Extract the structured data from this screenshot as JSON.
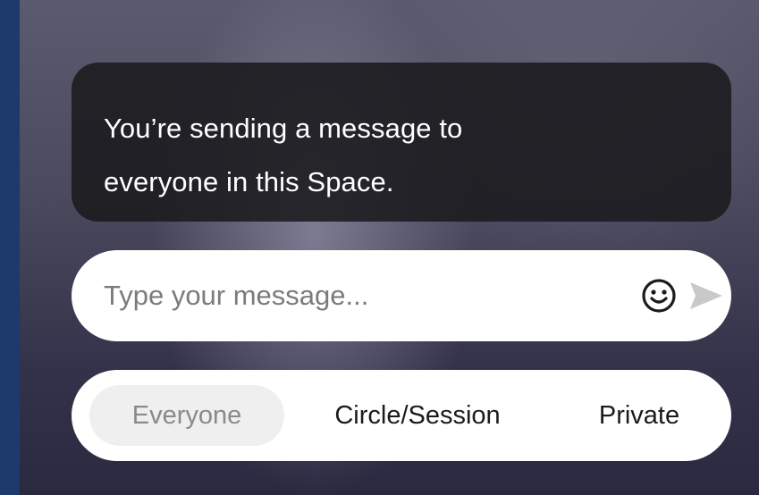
{
  "notice": {
    "line1": "You’re sending a message to",
    "line2": "everyone in this Space."
  },
  "composer": {
    "placeholder": "Type your message...",
    "emoji_icon": "smiley-face-icon",
    "send_icon": "paper-plane-send-icon"
  },
  "audience": {
    "options": [
      "Everyone",
      "Circle/Session",
      "Private"
    ],
    "selected": "Everyone"
  },
  "colors": {
    "notice_bg": "#1a1a1e",
    "panel_bg": "#ffffff",
    "active_segment_bg": "#efefef",
    "send_icon_color": "#c9c9cc"
  }
}
